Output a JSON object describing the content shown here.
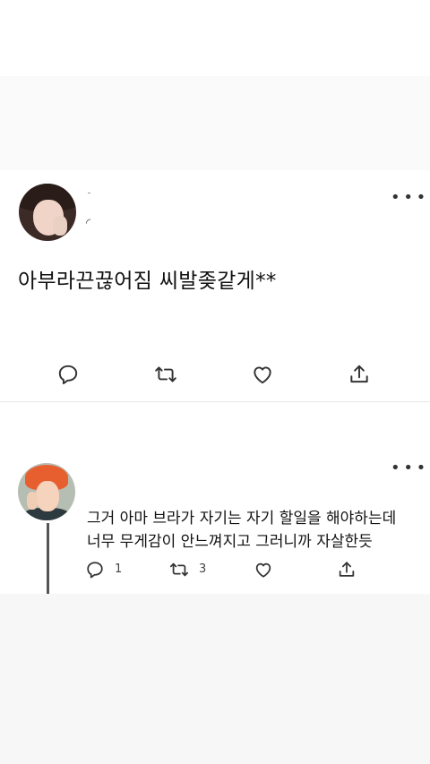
{
  "main_tweet": {
    "text": "아부라끈끊어짐 씨발좆같게**",
    "icons": [
      "reply-icon",
      "retweet-icon",
      "like-icon",
      "share-icon"
    ]
  },
  "reply_tweet": {
    "lines": [
      "그거 아마 브라가 자기는 자기 할일을 해야하는데",
      "너무 무게감이 안느껴지고 그러니까 자살한듯"
    ],
    "reply_count": "1",
    "retweet_count": "3",
    "icons": [
      "reply-icon",
      "retweet-icon",
      "like-icon",
      "share-icon"
    ]
  }
}
